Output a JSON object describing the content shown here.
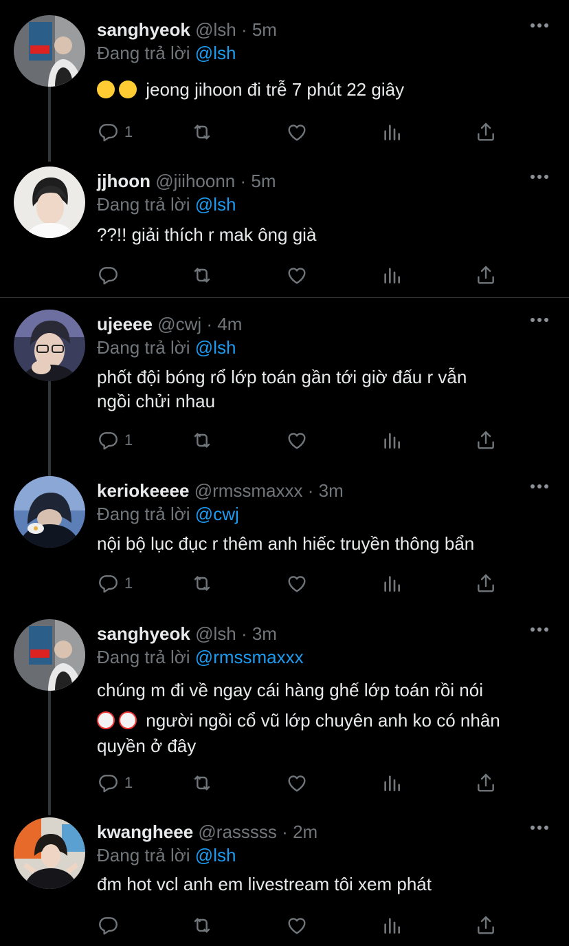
{
  "replying_prefix": "Đang trả lời",
  "tweets": [
    {
      "name": "sanghyeok",
      "handle": "@lsh",
      "time": "5m",
      "reply_to": "@lsh",
      "text": "jeong jihoon đi trễ 7 phút 22 giây",
      "reply_count": "1"
    },
    {
      "name": "jjhoon",
      "handle": "@jiihoonn",
      "time": "5m",
      "reply_to": "@lsh",
      "text": "??!! giải thích r mak ông già",
      "reply_count": ""
    },
    {
      "name": "ujeeee",
      "handle": "@cwj",
      "time": "4m",
      "reply_to": "@lsh",
      "text_line1": "phốt đội bóng rổ lớp toán gần tới giờ đấu r vẫn",
      "text_line2": "ngồi chửi nhau",
      "reply_count": "1"
    },
    {
      "name": "keriokeeee",
      "handle": "@rmssmaxxx",
      "time": "3m",
      "reply_to": "@cwj",
      "text": "nội bộ lục đục r thêm anh hiếc truyền thông bẩn",
      "reply_count": "1"
    },
    {
      "name": "sanghyeok",
      "handle": "@lsh",
      "time": "3m",
      "reply_to": "@rmssmaxxx",
      "text_line1": "chúng m đi về ngay cái hàng ghế lớp toán rồi nói",
      "text_line2": "người ngồi cổ vũ lớp chuyên anh ko có nhân",
      "text_line3": "quyền ở đây",
      "reply_count": "1"
    },
    {
      "name": "kwangheee",
      "handle": "@rasssss",
      "time": "2m",
      "reply_to": "@lsh",
      "text": "đm hot vcl anh em livestream tôi xem phát",
      "reply_count": ""
    }
  ],
  "icons": [
    "reply-icon",
    "retweet-icon",
    "like-icon",
    "views-icon",
    "share-icon",
    "more-icon",
    "smile-emoji",
    "clown-emoji"
  ],
  "colors": {
    "background": "#000000",
    "text": "#e7e9ea",
    "muted": "#71767b",
    "link": "#1d9bf0",
    "divider": "#2f3336"
  }
}
